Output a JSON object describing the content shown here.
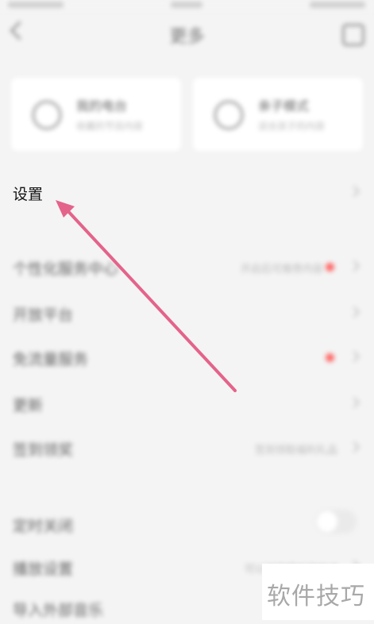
{
  "status": {},
  "header": {
    "title": "更多"
  },
  "cards": [
    {
      "title": "我的电台",
      "subtitle": "收藏的节目内容"
    },
    {
      "title": "亲子模式",
      "subtitle": "适合孩子的内容"
    }
  ],
  "settings_label": "设置",
  "rows": [
    {
      "label": "个性化服务中心",
      "value": "开启后可推荐内容"
    },
    {
      "label": "开放平台",
      "value": ""
    },
    {
      "label": "免流量服务",
      "value": ""
    },
    {
      "label": "更新",
      "value": ""
    },
    {
      "label": "签到领奖",
      "value": "签到领取福利礼品"
    },
    {
      "label": "定时关闭",
      "value": ""
    },
    {
      "label": "播放设置",
      "value": "可以选择播放器样式"
    },
    {
      "label": "导入外部音乐",
      "value": ""
    }
  ],
  "watermark": "软件技巧",
  "colors": {
    "arrow": "#e4638a",
    "badge": "#ff6a6a"
  }
}
